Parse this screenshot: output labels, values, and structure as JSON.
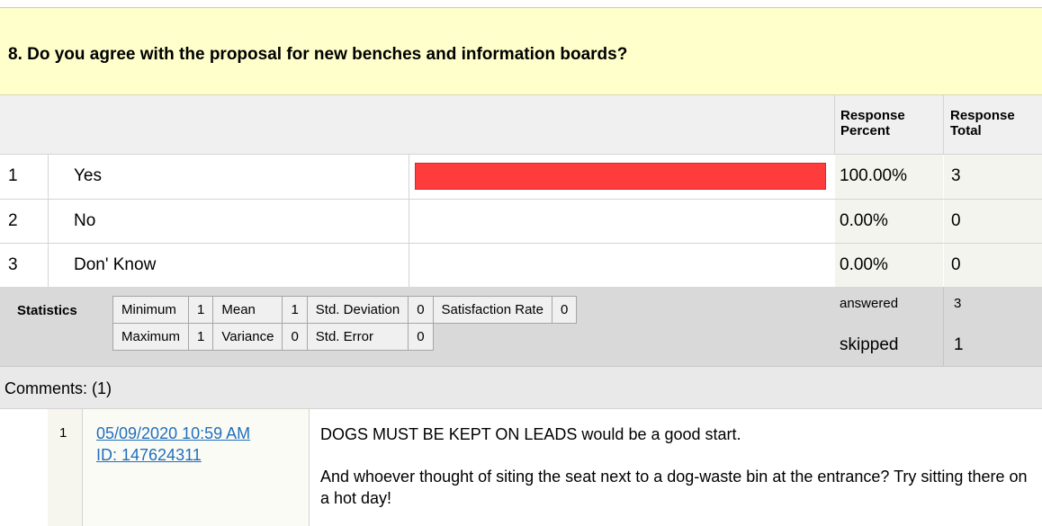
{
  "question": {
    "title": "8. Do you agree with the proposal for new benches and information boards?"
  },
  "table_header": {
    "response_percent": "Response Percent",
    "response_total": "Response Total"
  },
  "answers": [
    {
      "num": "1",
      "label": "Yes",
      "percent": "100.00%",
      "total": "3",
      "fraction": 1.0
    },
    {
      "num": "2",
      "label": "No",
      "percent": "0.00%",
      "total": "0",
      "fraction": 0.0
    },
    {
      "num": "3",
      "label": "Don' Know",
      "percent": "0.00%",
      "total": "0",
      "fraction": 0.0
    }
  ],
  "statistics": {
    "label": "Statistics",
    "minimum_label": "Minimum",
    "minimum": "1",
    "mean_label": "Mean",
    "mean": "1",
    "std_dev_label": "Std. Deviation",
    "std_dev": "0",
    "satisfaction_label": "Satisfaction Rate",
    "satisfaction": "0",
    "maximum_label": "Maximum",
    "maximum": "1",
    "variance_label": "Variance",
    "variance": "0",
    "std_error_label": "Std. Error",
    "std_error": "0"
  },
  "summary": {
    "answered_label": "answered",
    "answered": "3",
    "skipped_label": "skipped",
    "skipped": "1"
  },
  "comments": {
    "label": "Comments: (1)",
    "items": [
      {
        "num": "1",
        "date": "05/09/2020 10:59 AM",
        "id": "ID: 147624311",
        "line1": "DOGS MUST BE KEPT ON LEADS would be a good start.",
        "line2": "And whoever thought of siting the seat next to a dog-waste bin at the entrance? Try sitting there on a hot day!"
      }
    ]
  },
  "colors": {
    "header_bg": "#ffffcc",
    "bar": "#ff3c3c",
    "link": "#1f6fbf"
  }
}
